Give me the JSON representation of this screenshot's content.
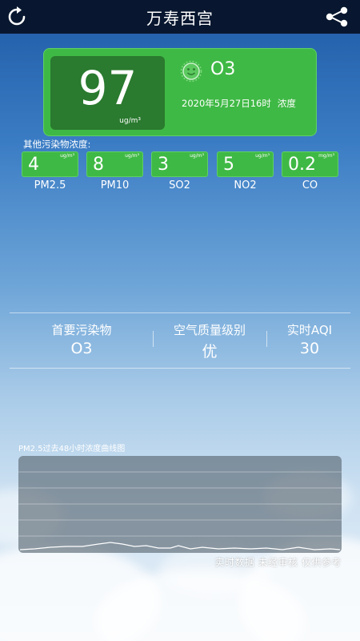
{
  "header": {
    "title": "万寿西宫",
    "left_icon": "refresh-icon",
    "right_icon": "share-icon"
  },
  "main_card": {
    "aqi": "97",
    "unit": "ug/m³",
    "pollutant": "O3",
    "face_icon": "smile-face-icon",
    "timestamp": "2020年5月27日16时",
    "concentration_label": "浓度",
    "color": "#3fb945"
  },
  "others": {
    "label": "其他污染物浓度:",
    "items": [
      {
        "name": "PM2.5",
        "value": "4",
        "unit": "ug/m³"
      },
      {
        "name": "PM10",
        "value": "8",
        "unit": "ug/m³"
      },
      {
        "name": "SO2",
        "value": "3",
        "unit": "ug/m³"
      },
      {
        "name": "NO2",
        "value": "5",
        "unit": "ug/m³"
      },
      {
        "name": "CO",
        "value": "0.2",
        "unit": "mg/m³"
      }
    ]
  },
  "summary": {
    "primary_label": "首要污染物",
    "primary_value": "O3",
    "level_label": "空气质量级别",
    "level_value": "优",
    "aqi_label": "实时AQI",
    "aqi_value": "30"
  },
  "chart": {
    "title": "PM2.5过去48小时浓度曲线图",
    "disclaimer": "实时数据 未经审核 仅供参考"
  }
}
